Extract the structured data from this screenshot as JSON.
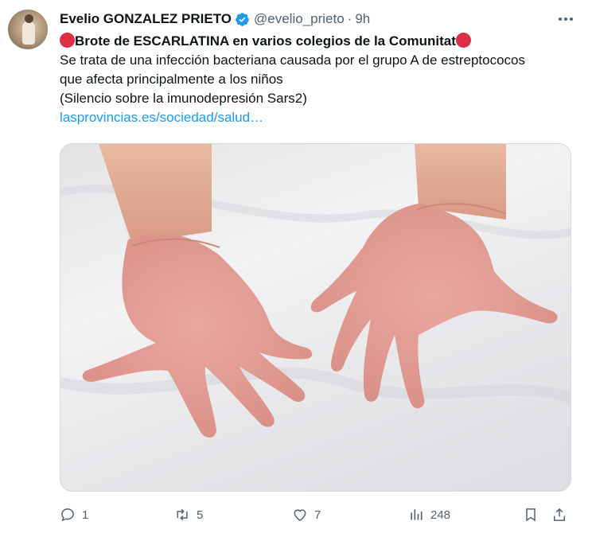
{
  "tweet": {
    "author_name": "Evelio GONZALEZ PRIETO",
    "handle": "@evelio_prieto",
    "separator": "·",
    "time": "9h",
    "headline": "Brote de ESCARLATINA en varios colegios de la Comunitat",
    "body_line1": "Se trata de una infección bacteriana causada por el grupo A de estreptococos",
    "body_line2": "que afecta principalmente a los niños",
    "body_line3": "(Silencio sobre la imunodepresión Sars2)",
    "link_text": "lasprovincias.es/sociedad/salud…"
  },
  "metrics": {
    "replies": "1",
    "retweets": "5",
    "likes": "7",
    "views": "248"
  },
  "icons": [
    "verified-badge-icon",
    "more-options-icon",
    "red-circle-icon",
    "reply-icon",
    "retweet-icon",
    "like-icon",
    "views-icon",
    "bookmark-icon",
    "share-icon"
  ],
  "colors": {
    "link": "#1d9bf0",
    "verified": "#1d9bf0",
    "secondary_text": "#536471",
    "red_circle": "#dd2e44"
  }
}
